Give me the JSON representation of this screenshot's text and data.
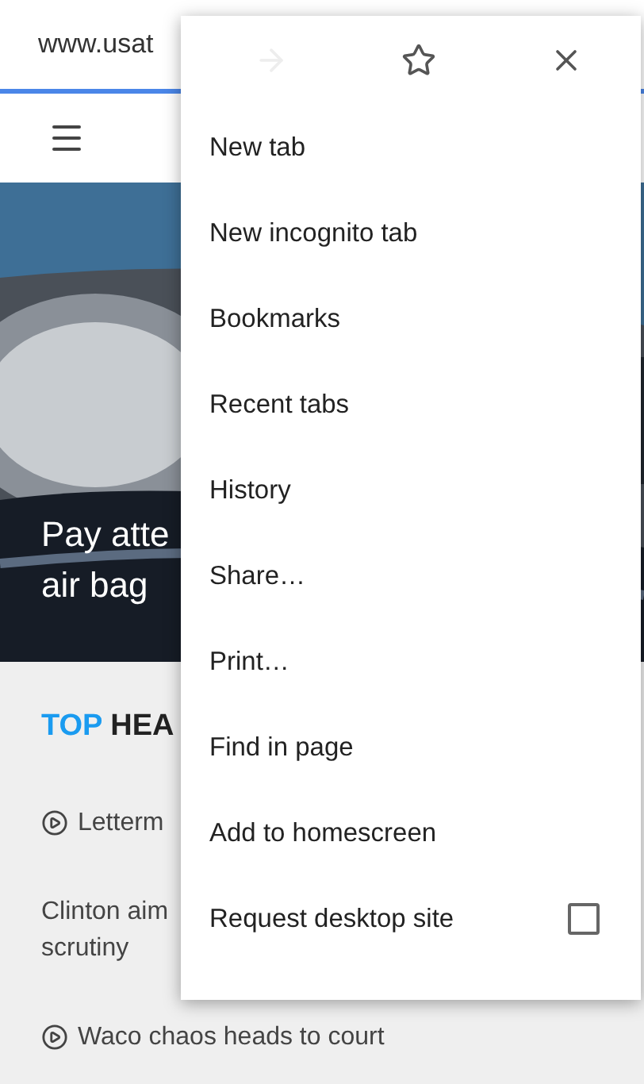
{
  "address_bar": {
    "url": "www.usat"
  },
  "page": {
    "hero_caption": [
      "Pay atte",
      "air bag"
    ],
    "section_title": {
      "accent": "TOP",
      "rest": "HEA"
    },
    "headlines": [
      {
        "kind": "video",
        "text": "Letterm"
      },
      {
        "kind": "text",
        "text": "Clinton aim\nscrutiny"
      },
      {
        "kind": "video",
        "text": "Waco chaos heads to court"
      }
    ]
  },
  "menu": {
    "toolbar": [
      {
        "kind": "forward",
        "disabled": true
      },
      {
        "kind": "bookmark",
        "disabled": false
      },
      {
        "kind": "close",
        "disabled": false
      }
    ],
    "items": [
      {
        "label": "New tab"
      },
      {
        "label": "New incognito tab"
      },
      {
        "label": "Bookmarks"
      },
      {
        "label": "Recent tabs"
      },
      {
        "label": "History"
      },
      {
        "label": "Share…"
      },
      {
        "label": "Print…"
      },
      {
        "label": "Find in page"
      },
      {
        "label": "Add to homescreen"
      },
      {
        "label": "Request desktop site",
        "checked": false
      }
    ]
  }
}
